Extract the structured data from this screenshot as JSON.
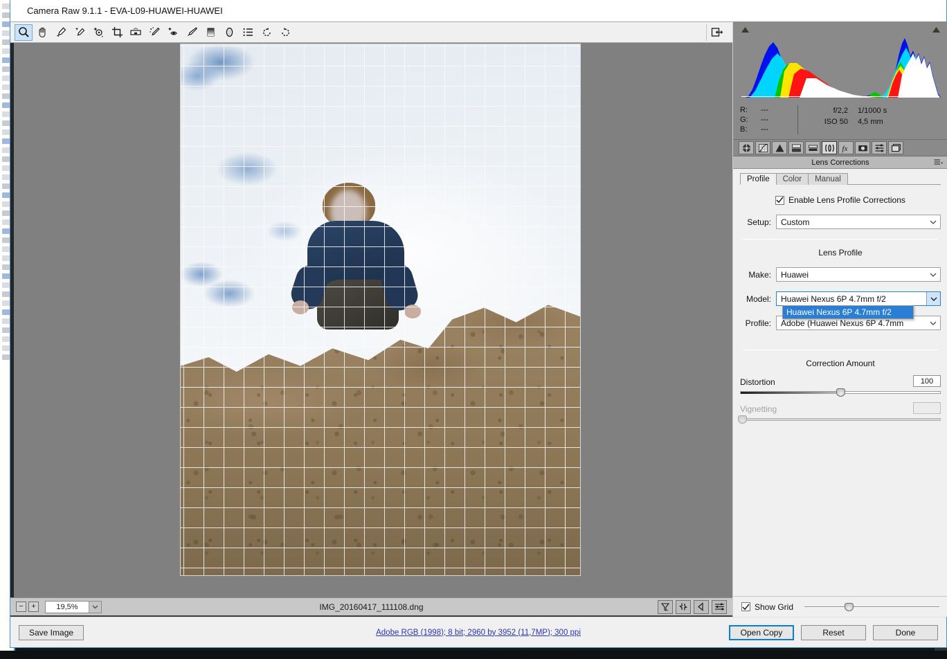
{
  "window": {
    "title": "Camera Raw 9.1.1  -  EVA-L09-HUAWEI-HUAWEI"
  },
  "toolbar": {
    "tools": [
      {
        "name": "zoom-tool",
        "title": "Zoom Tool",
        "active": true
      },
      {
        "name": "hand-tool",
        "title": "Hand Tool",
        "active": false
      },
      {
        "name": "white-balance-tool",
        "title": "White Balance Tool",
        "active": false
      },
      {
        "name": "color-sampler-tool",
        "title": "Color Sampler Tool",
        "active": false
      },
      {
        "name": "targeted-adjustment-tool",
        "title": "Targeted Adjustment Tool",
        "active": false
      },
      {
        "name": "crop-tool",
        "title": "Crop Tool",
        "active": false
      },
      {
        "name": "straighten-tool",
        "title": "Straighten Tool",
        "active": false
      },
      {
        "name": "spot-removal-tool",
        "title": "Spot Removal",
        "active": false
      },
      {
        "name": "red-eye-removal-tool",
        "title": "Red Eye Removal",
        "active": false
      },
      {
        "name": "adjustment-brush-tool",
        "title": "Adjustment Brush",
        "active": false
      },
      {
        "name": "graduated-filter-tool",
        "title": "Graduated Filter",
        "active": false
      },
      {
        "name": "radial-filter-tool",
        "title": "Radial Filter",
        "active": false
      },
      {
        "name": "preferences-tool",
        "title": "Open Preferences Dialog",
        "active": false
      },
      {
        "name": "rotate-left-tool",
        "title": "Rotate Image Counterclockwise",
        "active": false
      },
      {
        "name": "rotate-right-tool",
        "title": "Rotate Image Clockwise",
        "active": false
      }
    ],
    "toggle_filmstrip_icon": "toggle-filmstrip-icon"
  },
  "histogram": {
    "shadow_clipping_icon": "shadow-clipping-warning-icon",
    "highlight_clipping_icon": "highlight-clipping-warning-icon",
    "rgb": [
      {
        "label": "R:",
        "value": "---"
      },
      {
        "label": "G:",
        "value": "---"
      },
      {
        "label": "B:",
        "value": "---"
      }
    ],
    "exif": [
      {
        "c1": "f/2,2",
        "c2": "1/1000 s"
      },
      {
        "c1": "ISO 50",
        "c2": "4,5 mm"
      }
    ]
  },
  "panel_icons": [
    {
      "name": "basic-panel-icon",
      "selected": false
    },
    {
      "name": "tone-curve-panel-icon",
      "selected": false
    },
    {
      "name": "detail-panel-icon",
      "selected": false
    },
    {
      "name": "hsl-grayscale-panel-icon",
      "selected": false
    },
    {
      "name": "split-toning-panel-icon",
      "selected": false
    },
    {
      "name": "lens-corrections-panel-icon",
      "selected": true
    },
    {
      "name": "effects-panel-icon",
      "selected": false
    },
    {
      "name": "camera-calibration-panel-icon",
      "selected": false
    },
    {
      "name": "presets-panel-icon",
      "selected": false
    },
    {
      "name": "snapshots-panel-icon",
      "selected": false
    }
  ],
  "panel": {
    "title": "Lens Corrections",
    "menu_icon": "panel-menu-icon",
    "tabs": [
      {
        "label": "Profile",
        "active": true
      },
      {
        "label": "Color",
        "active": false
      },
      {
        "label": "Manual",
        "active": false
      }
    ],
    "enable_checkbox": {
      "label": "Enable Lens Profile Corrections",
      "checked": true
    },
    "setup": {
      "label": "Setup:",
      "value": "Custom"
    },
    "lens_profile_title": "Lens Profile",
    "make": {
      "label": "Make:",
      "value": "Huawei"
    },
    "model": {
      "label": "Model:",
      "value": "Huawei Nexus 6P 4.7mm f/2"
    },
    "profile": {
      "label": "Profile:",
      "value": "Adobe (Huawei Nexus 6P 4.7mm"
    },
    "dropdown_open": {
      "options": [
        {
          "label": "Huawei Nexus 6P 4.7mm f/2",
          "highlighted": true
        }
      ]
    },
    "correction_amount_title": "Correction Amount",
    "sliders": [
      {
        "name": "Distortion",
        "value": "100",
        "position_pct": 50,
        "enabled": true
      },
      {
        "name": "Vignetting",
        "value": "",
        "position_pct": 0,
        "enabled": false
      }
    ],
    "show_grid": {
      "label": "Show Grid",
      "checked": true,
      "slider_position_pct": 33
    }
  },
  "status_bar": {
    "zoom_out_label": "−",
    "zoom_in_label": "+",
    "zoom_value": "19,5%",
    "filename": "IMG_20160417_111108.dng",
    "buttons": [
      {
        "name": "white-balance-preview-button"
      },
      {
        "name": "sync-settings-button"
      },
      {
        "name": "previous-image-button"
      },
      {
        "name": "filmstrip-settings-button"
      }
    ]
  },
  "action_bar": {
    "save_image_label": "Save Image",
    "workflow_link": "Adobe RGB (1998); 8 bit; 2960 by 3952 (11,7MP); 300 ppi",
    "open_copy_label": "Open Copy",
    "reset_label": "Reset",
    "done_label": "Done"
  },
  "colors": {
    "accent": "#0c7cd5",
    "panel_bg": "#f0f0f0",
    "histogram_bg": "#8a8a8a",
    "canvas_bg": "#808080",
    "link": "#2a35b8",
    "selection": "#2a7fd4"
  }
}
